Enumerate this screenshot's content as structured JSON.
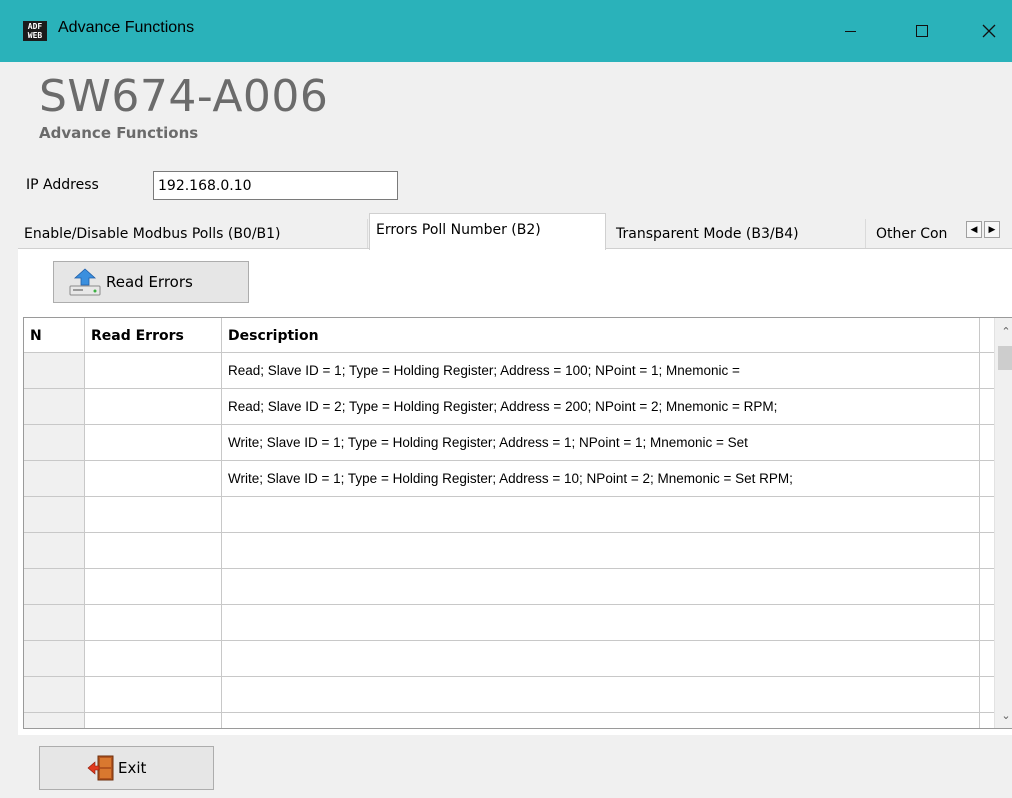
{
  "window": {
    "title": "Advance Functions",
    "icon_text_top": "ADF",
    "icon_text_bottom": "WEB",
    "accent_color": "#2ab2ba"
  },
  "header": {
    "product": "SW674-A006",
    "subtitle": "Advance Functions"
  },
  "ip": {
    "label": "IP Address",
    "value": "192.168.0.10"
  },
  "tabs": [
    {
      "label": "Enable/Disable Modbus Polls (B0/B1)",
      "active": false
    },
    {
      "label": "Errors Poll Number (B2)",
      "active": true
    },
    {
      "label": "Transparent Mode (B3/B4)",
      "active": false
    },
    {
      "label": "Other Con",
      "active": false
    }
  ],
  "toolbar": {
    "read_errors_label": "Read Errors",
    "read_errors_icon": "upload-drive-icon"
  },
  "grid": {
    "columns": [
      "N",
      "Read Errors",
      "Description"
    ],
    "rows": [
      {
        "n": "",
        "read_errors": "",
        "description": "Read; Slave ID = 1; Type = Holding Register; Address = 100; NPoint = 1; Mnemonic ="
      },
      {
        "n": "",
        "read_errors": "",
        "description": "Read; Slave ID = 2; Type = Holding Register; Address = 200; NPoint = 2; Mnemonic = RPM;"
      },
      {
        "n": "",
        "read_errors": "",
        "description": "Write; Slave ID = 1; Type = Holding Register; Address = 1; NPoint = 1; Mnemonic = Set"
      },
      {
        "n": "",
        "read_errors": "",
        "description": "Write; Slave ID = 1; Type = Holding Register; Address = 10; NPoint = 2; Mnemonic = Set RPM;"
      },
      {
        "n": "",
        "read_errors": "",
        "description": ""
      },
      {
        "n": "",
        "read_errors": "",
        "description": ""
      },
      {
        "n": "",
        "read_errors": "",
        "description": ""
      },
      {
        "n": "",
        "read_errors": "",
        "description": ""
      },
      {
        "n": "",
        "read_errors": "",
        "description": ""
      },
      {
        "n": "",
        "read_errors": "",
        "description": ""
      },
      {
        "n": "",
        "read_errors": "",
        "description": ""
      }
    ]
  },
  "footer": {
    "exit_label": "Exit",
    "exit_icon": "exit-door-icon"
  }
}
